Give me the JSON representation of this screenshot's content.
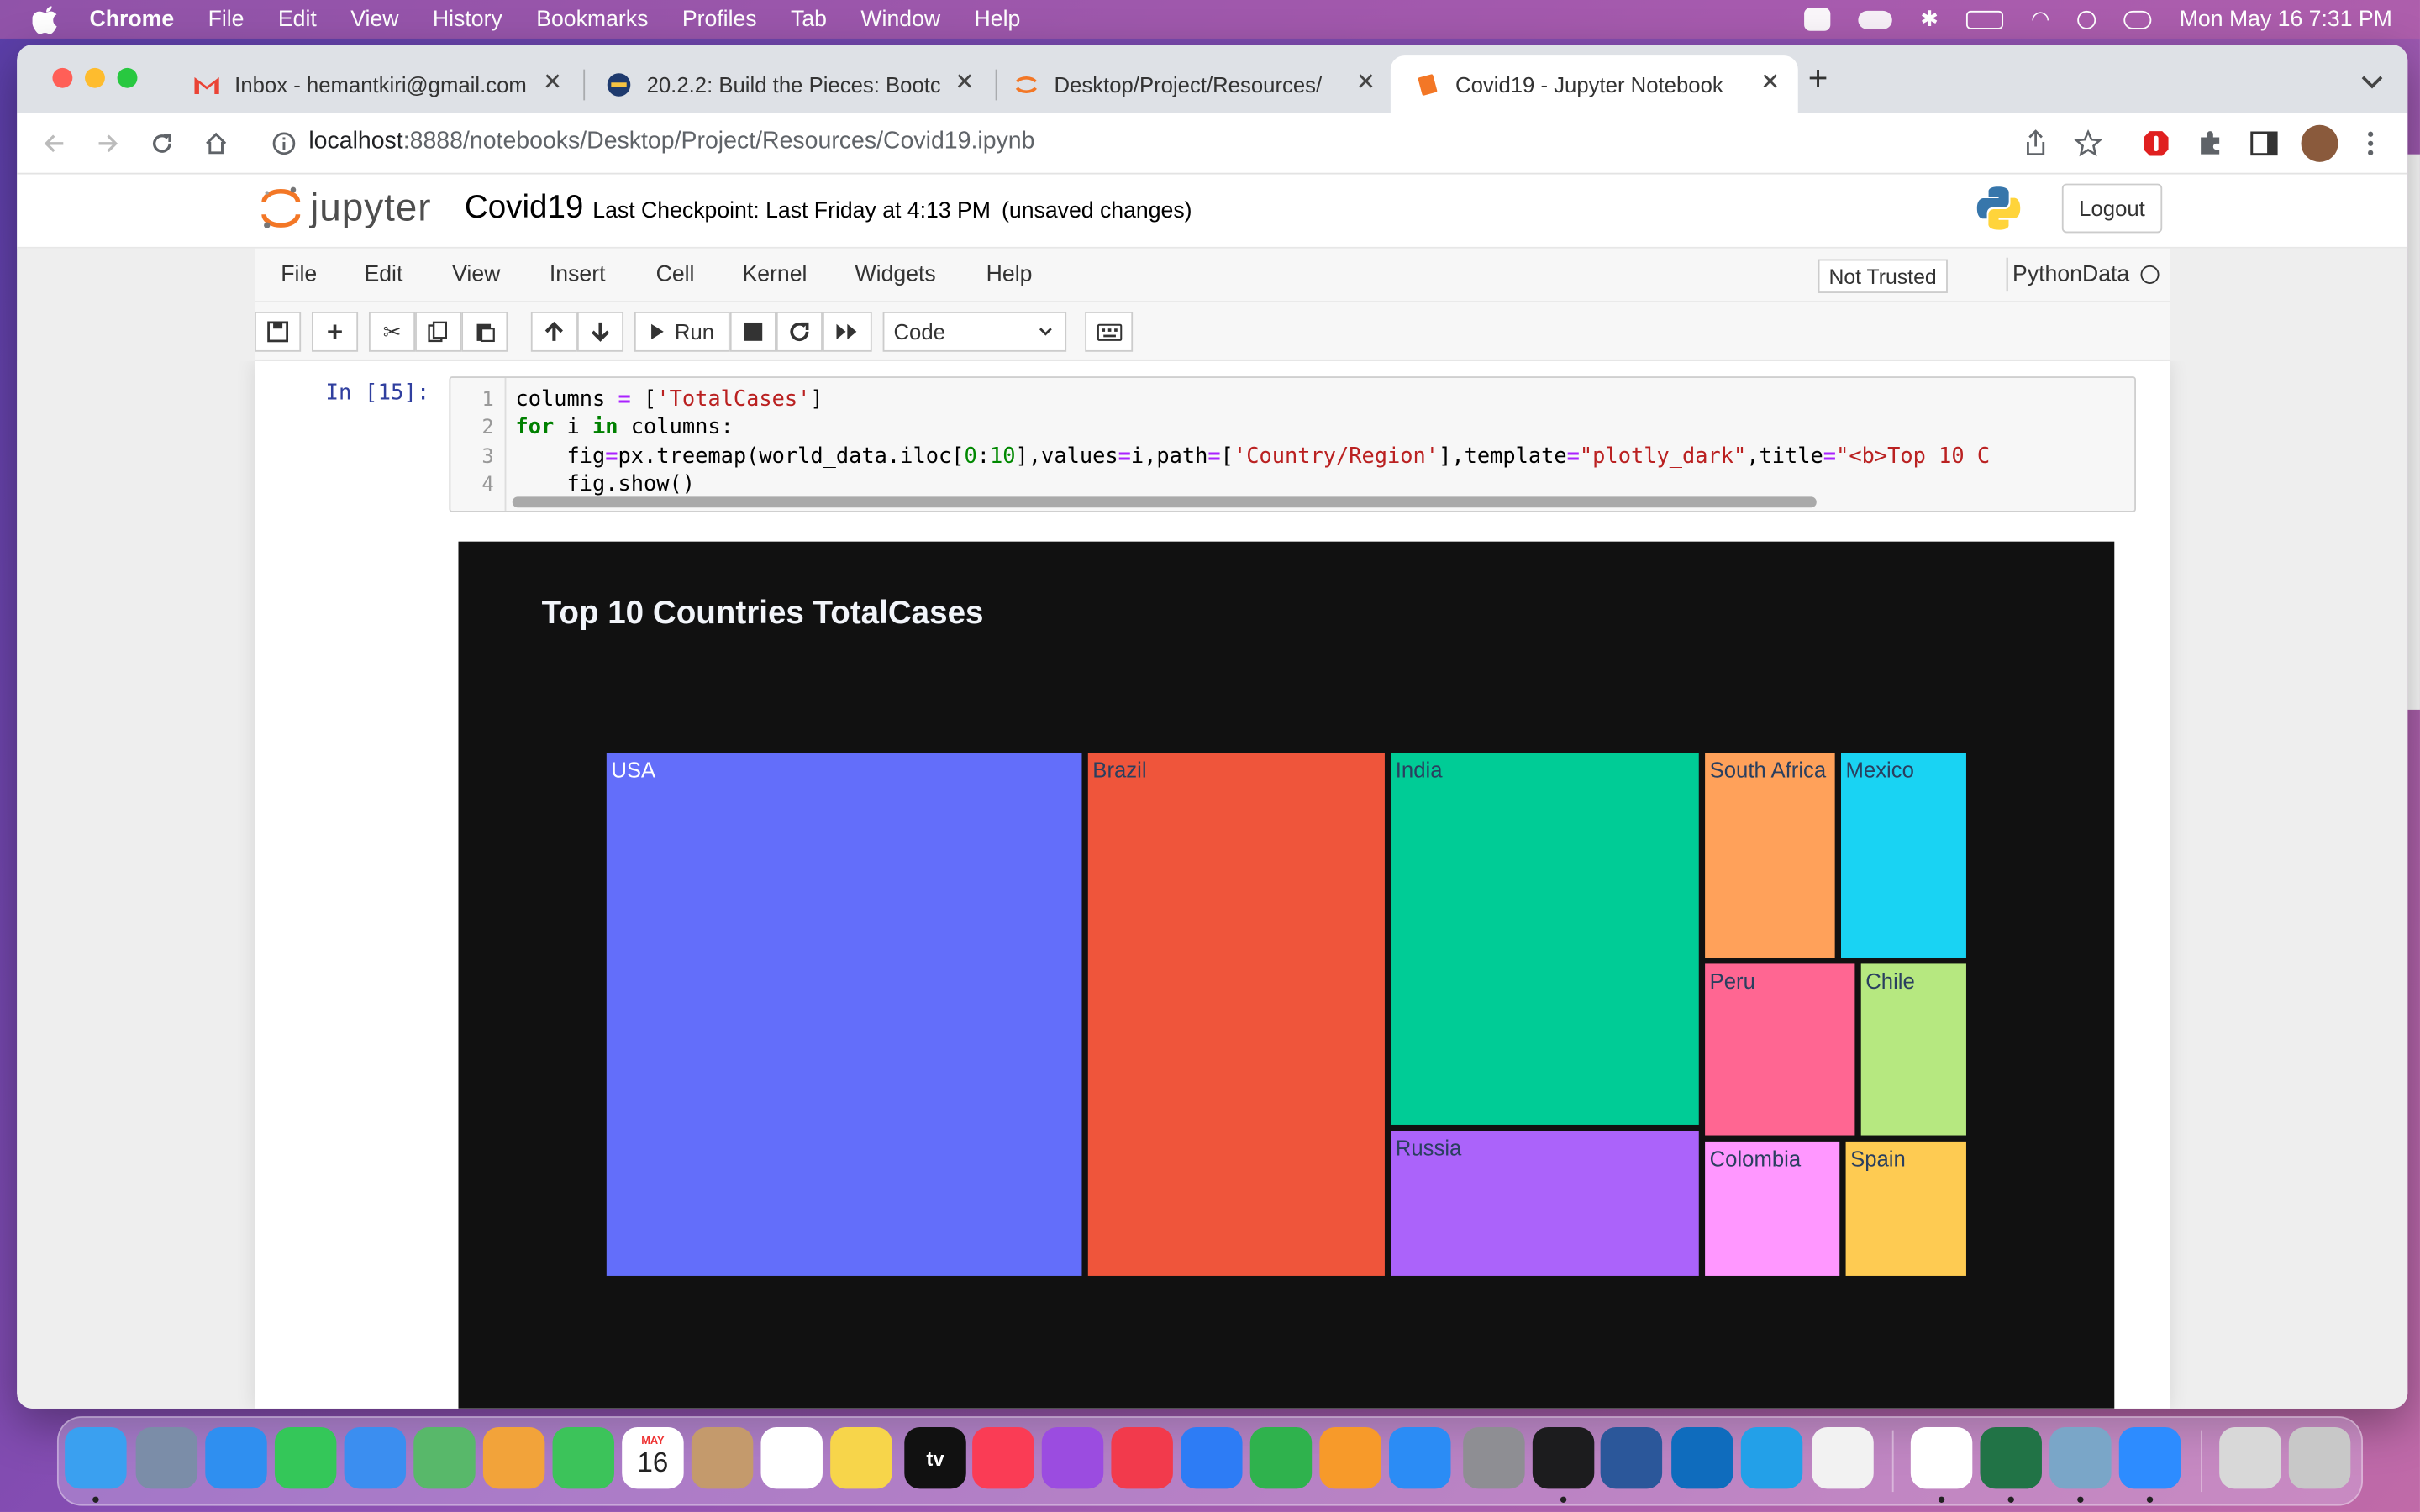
{
  "menubar": {
    "app_name": "Chrome",
    "items": [
      "File",
      "Edit",
      "View",
      "History",
      "Bookmarks",
      "Profiles",
      "Tab",
      "Window",
      "Help"
    ],
    "clock": "Mon May 16  7:31 PM"
  },
  "browser": {
    "tabs": [
      {
        "title": "Inbox - hemantkiri@gmail.com",
        "icon": "gmail-icon"
      },
      {
        "title": "20.2.2: Build the Pieces: Bootc",
        "icon": "course-icon"
      },
      {
        "title": "Desktop/Project/Resources/",
        "icon": "jupyter-icon"
      },
      {
        "title": "Covid19 - Jupyter Notebook",
        "icon": "notebook-icon"
      }
    ],
    "url_host": "localhost",
    "url_path": ":8888/notebooks/Desktop/Project/Resources/Covid19.ipynb"
  },
  "jupyter": {
    "logo_text": "jupyter",
    "notebook_name": "Covid19",
    "checkpoint": "Last Checkpoint: Last Friday at 4:13 PM",
    "unsaved": "(unsaved changes)",
    "logout": "Logout",
    "menu": [
      "File",
      "Edit",
      "View",
      "Insert",
      "Cell",
      "Kernel",
      "Widgets",
      "Help"
    ],
    "trust": "Not Trusted",
    "kernel": "PythonData",
    "run_label": "Run",
    "cell_type": "Code"
  },
  "cell": {
    "prompt": "In [15]:",
    "line_numbers": [
      "1",
      "2",
      "3",
      "4"
    ]
  },
  "chart_data": {
    "type": "treemap",
    "title": "Top 10 Countries TotalCases",
    "labels": [
      "USA",
      "Brazil",
      "India",
      "Russia",
      "South Africa",
      "Mexico",
      "Peru",
      "Chile",
      "Colombia",
      "Spain"
    ],
    "colors": [
      "#636efa",
      "#ef553b",
      "#00cc96",
      "#ab63fa",
      "#ffa15a",
      "#19d3f3",
      "#ff6692",
      "#b6e880",
      "#ff97ff",
      "#fecb52"
    ],
    "values": [
      5150000,
      3240000,
      2400000,
      960000,
      580000,
      560000,
      560000,
      400000,
      400000,
      360000
    ]
  },
  "dock": {
    "apps": [
      "finder-icon",
      "launchpad-icon",
      "safari-icon",
      "messages-icon",
      "mail-icon",
      "maps-icon",
      "photos-icon",
      "facetime-icon",
      "calendar-icon",
      "contacts-icon",
      "reminders-icon",
      "notes-icon",
      "tv-icon",
      "music-icon",
      "podcasts-icon",
      "news-icon",
      "keynote-icon",
      "numbers-icon",
      "pages-icon",
      "appstore-icon",
      "settings-icon",
      "terminal-icon",
      "word-icon",
      "outlook-icon",
      "vscode-icon",
      "textedit-icon",
      "chrome-icon",
      "excel-icon",
      "postgres-icon",
      "zoom-icon",
      "documents-icon",
      "trash-icon"
    ],
    "calendar_month": "MAY",
    "calendar_day": "16",
    "tv_label": "tv"
  }
}
